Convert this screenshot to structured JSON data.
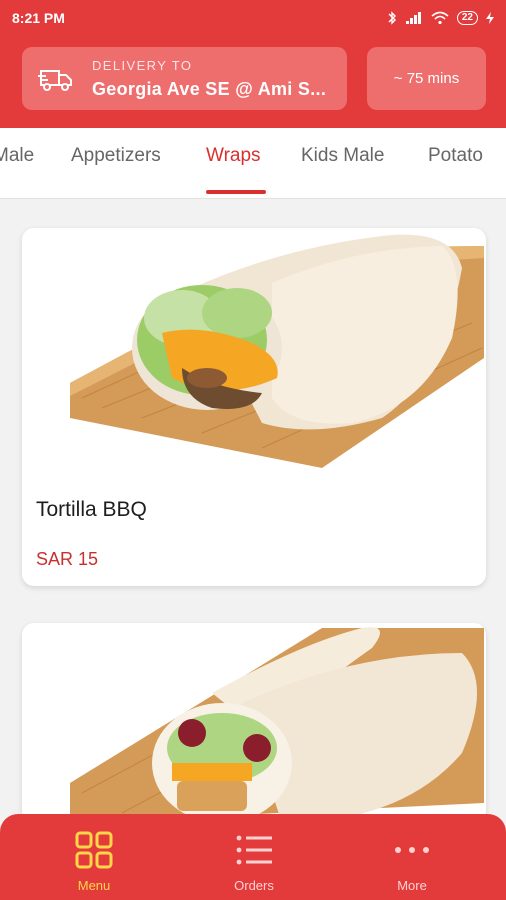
{
  "status_bar": {
    "time": "8:21 PM",
    "battery": "22"
  },
  "header": {
    "delivery_label": "DELIVERY TO",
    "delivery_address": "Georgia Ave SE @ Ami S...",
    "eta": "~ 75 mins"
  },
  "tabs": {
    "items": [
      {
        "label": "Male"
      },
      {
        "label": "Appetizers"
      },
      {
        "label": "Wraps",
        "active": true
      },
      {
        "label": "Kids Male"
      },
      {
        "label": "Potato"
      }
    ]
  },
  "products": [
    {
      "name": "Tortilla BBQ",
      "price": "SAR 15"
    },
    {
      "name": "",
      "price": ""
    }
  ],
  "bottom_nav": {
    "items": [
      {
        "label": "Menu",
        "icon": "grid-icon",
        "active": true
      },
      {
        "label": "Orders",
        "icon": "list-icon"
      },
      {
        "label": "More",
        "icon": "more-dots-icon"
      }
    ]
  },
  "colors": {
    "brand_red": "#e33b3b",
    "card_red": "#ee6e6e",
    "active_tab": "#d9302f",
    "price": "#c8302e",
    "nav_active": "#ffd54a"
  }
}
